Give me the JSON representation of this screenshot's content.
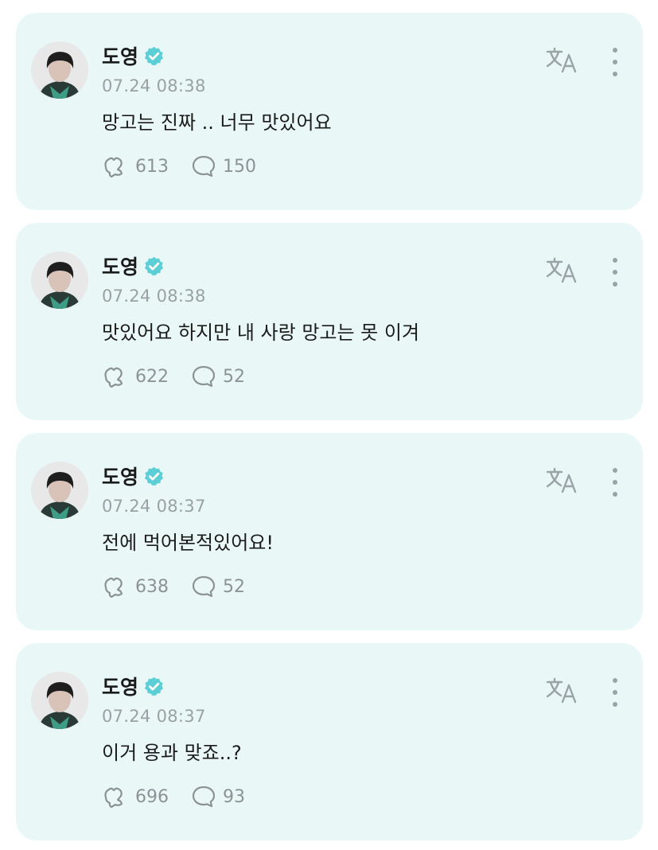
{
  "posts": [
    {
      "author": "도영",
      "timestamp": "07.24 08:38",
      "content": "망고는 진짜 .. 너무 맛있어요",
      "likes": "613",
      "comments": "150"
    },
    {
      "author": "도영",
      "timestamp": "07.24 08:38",
      "content": "맛있어요 하지만 내 사랑 망고는 못 이겨",
      "likes": "622",
      "comments": "52"
    },
    {
      "author": "도영",
      "timestamp": "07.24 08:37",
      "content": "전에 먹어본적있어요!",
      "likes": "638",
      "comments": "52"
    },
    {
      "author": "도영",
      "timestamp": "07.24 08:37",
      "content": "이거 용과 맞죠..?",
      "likes": "696",
      "comments": "93"
    }
  ],
  "icons": {
    "verified": "verified-badge-icon",
    "translate": "translate-icon",
    "more": "more-vertical-icon",
    "like": "heart-hands-icon",
    "comment": "comment-bubble-icon"
  },
  "colors": {
    "card_background": "#e9f8f6",
    "verified_badge": "#5ccfd6",
    "icon_gray": "#9aa3a6",
    "text_primary": "#1b1b1b",
    "text_secondary": "#9aa0a3"
  }
}
